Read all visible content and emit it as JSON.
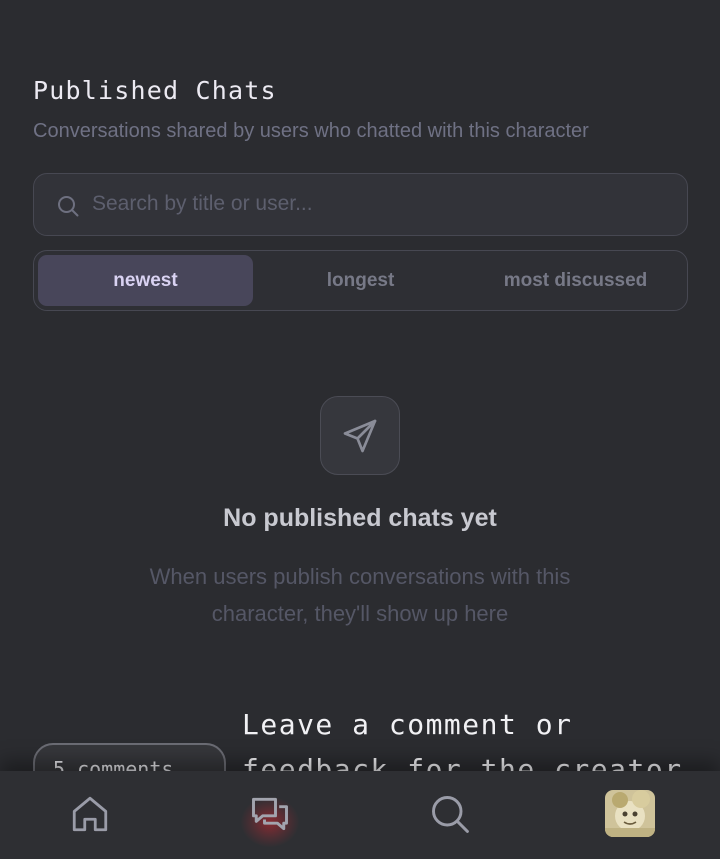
{
  "published": {
    "title": "Published Chats",
    "subtitle": "Conversations shared by users who chatted with this character"
  },
  "search": {
    "placeholder": "Search by title or user...",
    "value": "",
    "icon": "search-icon"
  },
  "sort_tabs": [
    {
      "label": "newest",
      "active": true
    },
    {
      "label": "longest",
      "active": false
    },
    {
      "label": "most discussed",
      "active": false
    }
  ],
  "empty_state": {
    "icon": "send-icon",
    "title": "No published chats yet",
    "description": "When users publish conversations with this character, they'll show up here"
  },
  "comments": {
    "pill_label": "5 comments",
    "heading": "Leave a comment or feedback for the creator"
  },
  "bottom_nav": {
    "items": [
      {
        "icon": "home-icon"
      },
      {
        "icon": "chat-bubbles-icon",
        "active": true
      },
      {
        "icon": "search-icon"
      },
      {
        "icon": "avatar"
      }
    ]
  },
  "colors": {
    "background": "#2b2c30",
    "active_tab_bg": "#48465a",
    "active_tab_text": "#d9d2f2",
    "nav_active_glow": "#d22832"
  }
}
